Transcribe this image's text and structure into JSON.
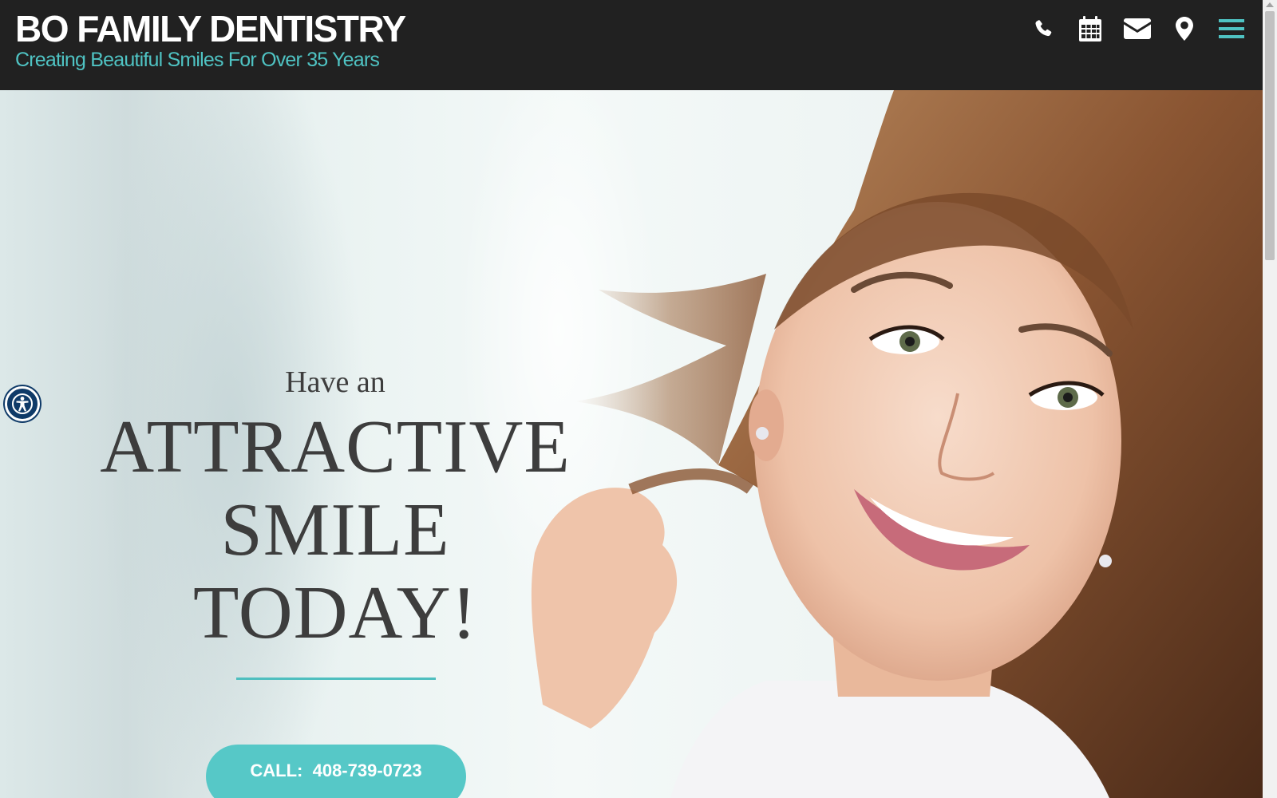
{
  "header": {
    "title": "BO FAMILY DENTISTRY",
    "tagline": "Creating Beautiful Smiles For Over 35 Years",
    "icons": [
      "phone-icon",
      "calendar-icon",
      "envelope-icon",
      "map-marker-icon",
      "menu-icon"
    ]
  },
  "hero": {
    "pre_heading": "Have an",
    "heading_line_1": "ATTRACTIVE",
    "heading_line_2": "SMILE",
    "heading_line_3": "TODAY!",
    "call_label": "CALL:  408-739-0723"
  },
  "accessibility": {
    "icon": "accessibility-icon"
  },
  "colors": {
    "header_bg": "#212121",
    "accent": "#4fc3c3",
    "button_bg": "#56c8c7",
    "heading_text": "#3d3d3d",
    "a11y_bg": "#0f3a68"
  }
}
